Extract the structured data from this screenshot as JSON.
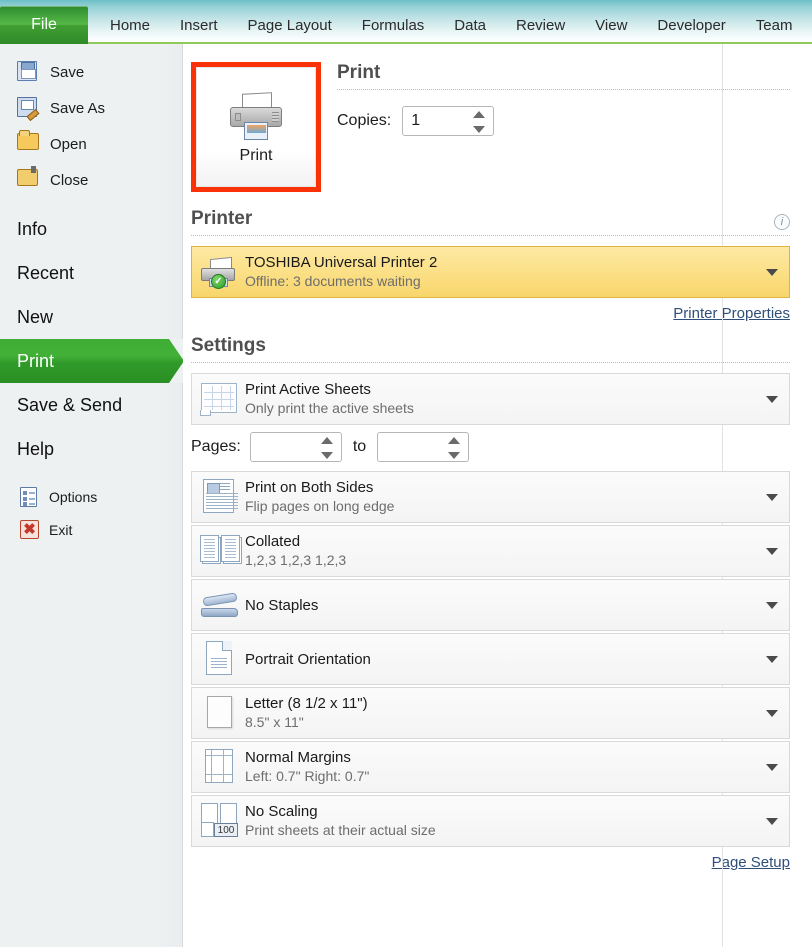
{
  "ribbon": {
    "file_tab": "File",
    "tabs": [
      "Home",
      "Insert",
      "Page Layout",
      "Formulas",
      "Data",
      "Review",
      "View",
      "Developer",
      "Team"
    ]
  },
  "sidebar": {
    "commands": [
      {
        "label": "Save",
        "icon": "save-icon"
      },
      {
        "label": "Save As",
        "icon": "save-as-icon"
      },
      {
        "label": "Open",
        "icon": "open-folder-icon"
      },
      {
        "label": "Close",
        "icon": "close-folder-icon"
      }
    ],
    "major": [
      {
        "label": "Info",
        "selected": false
      },
      {
        "label": "Recent",
        "selected": false
      },
      {
        "label": "New",
        "selected": false
      },
      {
        "label": "Print",
        "selected": true
      },
      {
        "label": "Save & Send",
        "selected": false
      },
      {
        "label": "Help",
        "selected": false
      }
    ],
    "small": [
      {
        "label": "Options",
        "icon": "options-icon"
      },
      {
        "label": "Exit",
        "icon": "exit-icon"
      }
    ],
    "selected_color": "#3fae35"
  },
  "print_pane": {
    "print_button_label": "Print",
    "print_button_highlight_color": "#fb3208",
    "heading": "Print",
    "copies_label": "Copies:",
    "copies_value": "1",
    "printer_section": {
      "heading": "Printer",
      "info_icon": "info-icon",
      "selected_printer": {
        "name": "TOSHIBA Universal Printer 2",
        "status": "Offline: 3 documents waiting",
        "highlight_color": "#fbdf84"
      },
      "properties_link": "Printer Properties"
    },
    "settings_section": {
      "heading": "Settings",
      "items": [
        {
          "title": "Print Active Sheets",
          "subtitle": "Only print the active sheets",
          "icon": "sheets-icon"
        },
        {
          "title": "Print on Both Sides",
          "subtitle": "Flip pages on long edge",
          "icon": "duplex-icon"
        },
        {
          "title": "Collated",
          "subtitle": "1,2,3   1,2,3   1,2,3",
          "icon": "collate-icon"
        },
        {
          "title": "No Staples",
          "subtitle": "",
          "icon": "stapler-icon"
        },
        {
          "title": "Portrait Orientation",
          "subtitle": "",
          "icon": "portrait-icon"
        },
        {
          "title": "Letter (8 1/2 x 11\")",
          "subtitle": "8.5\" x 11\"",
          "icon": "paper-size-icon"
        },
        {
          "title": "Normal Margins",
          "subtitle": "Left:  0.7\"   Right:  0.7\"",
          "icon": "margins-icon"
        },
        {
          "title": "No Scaling",
          "subtitle": "Print sheets at their actual size",
          "icon": "scaling-icon",
          "badge": "100"
        }
      ],
      "pages_label": "Pages:",
      "pages_from_value": "",
      "pages_to_word": "to",
      "pages_to_value": "",
      "page_setup_link": "Page Setup"
    }
  }
}
